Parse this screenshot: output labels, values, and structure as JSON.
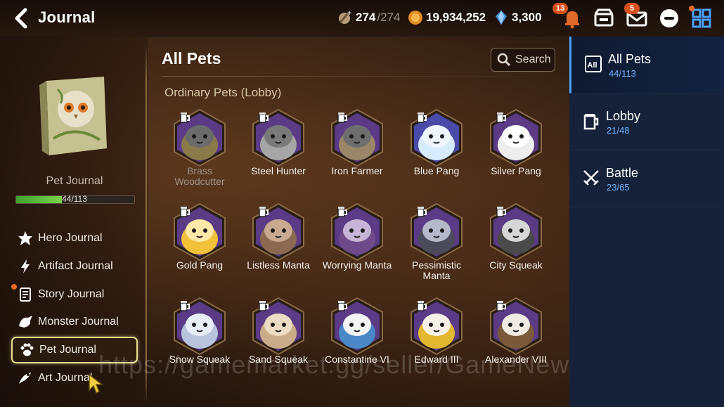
{
  "header": {
    "title": "Journal",
    "stamina": {
      "current": "274",
      "max": "/274"
    },
    "gold": "19,934,252",
    "crystals": "3,300",
    "notifications_badge": "13",
    "mail_badge": "5"
  },
  "left_panel": {
    "journal_label": "Pet Journal",
    "progress_text": "44/113",
    "progress_fraction": 0.389,
    "menu": [
      {
        "label": "Hero Journal",
        "icon": "hero-icon"
      },
      {
        "label": "Artifact Journal",
        "icon": "artifact-icon"
      },
      {
        "label": "Story Journal",
        "icon": "scroll-icon"
      },
      {
        "label": "Monster Journal",
        "icon": "monster-icon"
      },
      {
        "label": "Pet Journal",
        "icon": "paw-icon"
      },
      {
        "label": "Art Journal",
        "icon": "art-icon"
      }
    ]
  },
  "main": {
    "section_title": "All Pets",
    "search_label": "Search",
    "category_label": "Ordinary Pets (Lobby)",
    "pets": [
      {
        "name": "Brass Woodcutter",
        "body": "#8a7a4a",
        "face": "#6b6b6b",
        "hex": "#5b3a86",
        "owned": false
      },
      {
        "name": "Steel Hunter",
        "body": "#a6a6a6",
        "face": "#7a7a7a",
        "hex": "#5b3a86",
        "owned": true
      },
      {
        "name": "Iron Farmer",
        "body": "#9a8668",
        "face": "#6e6e6e",
        "hex": "#5b3a86",
        "owned": true
      },
      {
        "name": "Blue Pang",
        "body": "#d8ecff",
        "face": "#eef6ff",
        "hex": "#4a4aa8",
        "owned": true
      },
      {
        "name": "Silver Pang",
        "body": "#eeeeee",
        "face": "#ffffff",
        "hex": "#5b3a86",
        "owned": true
      },
      {
        "name": "Gold Pang",
        "body": "#f2c13a",
        "face": "#ffe9a8",
        "hex": "#5b3a86",
        "owned": true
      },
      {
        "name": "Listless Manta",
        "body": "#8c6a52",
        "face": "#c9aa90",
        "hex": "#5b3a86",
        "owned": true
      },
      {
        "name": "Worrying Manta",
        "body": "#6e4a8a",
        "face": "#c7b4d6",
        "hex": "#5b3a86",
        "owned": true
      },
      {
        "name": "Pessimistic Manta",
        "body": "#4a4a5a",
        "face": "#b4b8c8",
        "hex": "#5b3a86",
        "owned": true
      },
      {
        "name": "City Squeak",
        "body": "#4a4a4a",
        "face": "#d6d6d6",
        "hex": "#5b3a86",
        "owned": true
      },
      {
        "name": "Snow Squeak",
        "body": "#b8c4dc",
        "face": "#e8eef8",
        "hex": "#5b3a86",
        "owned": true
      },
      {
        "name": "Sand Squeak",
        "body": "#c9ad88",
        "face": "#ecdcc4",
        "hex": "#5b3a86",
        "owned": true
      },
      {
        "name": "Constantine VI",
        "body": "#4a88c8",
        "face": "#f4f4f4",
        "hex": "#5b3a86",
        "owned": true
      },
      {
        "name": "Edward III",
        "body": "#e2b830",
        "face": "#f6f0e6",
        "hex": "#5b3a86",
        "owned": true
      },
      {
        "name": "Alexander VIII",
        "body": "#7a5a3a",
        "face": "#f0ece4",
        "hex": "#5b3a86",
        "owned": true
      }
    ]
  },
  "right_panel": {
    "tabs": [
      {
        "label": "All Pets",
        "count": "44/113",
        "icon": "all-icon"
      },
      {
        "label": "Lobby",
        "count": "21/48",
        "icon": "lobby-mug-icon"
      },
      {
        "label": "Battle",
        "count": "23/65",
        "icon": "crossed-swords-icon"
      }
    ]
  },
  "watermark": "https://gamemarket.gg/seller/GameNews",
  "colors": {
    "accent_blue": "#6db4ff",
    "progress_green": "#5bbd3a",
    "badge_orange": "#d9501d"
  }
}
